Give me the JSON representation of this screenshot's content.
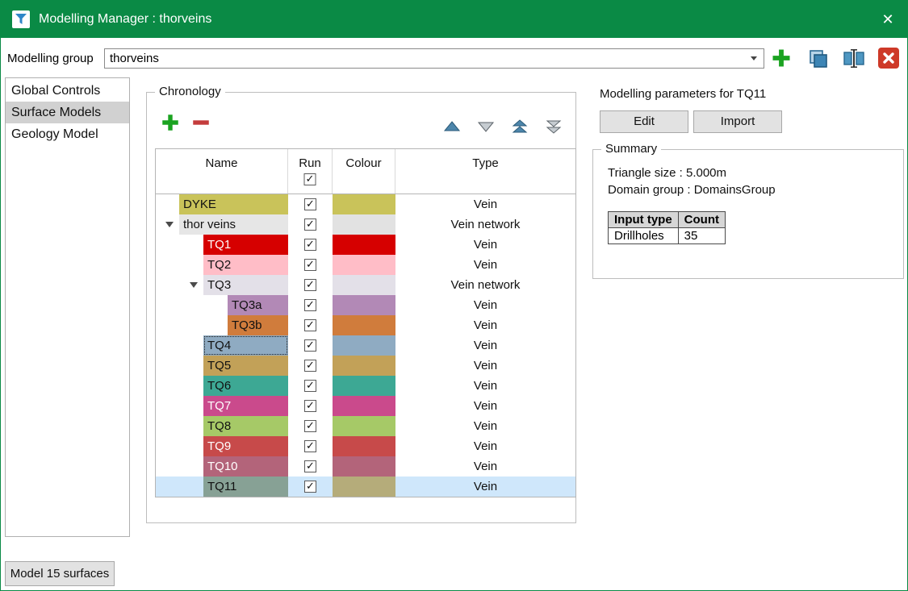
{
  "window": {
    "title": "Modelling Manager : thorveins",
    "close_icon": "✕"
  },
  "toolbar": {
    "group_label": "Modelling group",
    "group_value": "thorveins"
  },
  "icons": {
    "check": "✓"
  },
  "sidebar": {
    "items": [
      {
        "label": "Global Controls",
        "selected": false
      },
      {
        "label": "Surface Models",
        "selected": true
      },
      {
        "label": "Geology Model",
        "selected": false
      }
    ]
  },
  "chronology": {
    "title": "Chronology",
    "selection_color": "#cfe7fb",
    "header": {
      "name": "Name",
      "run": "Run",
      "colour": "Colour",
      "type": "Type",
      "run_all_checked": true
    },
    "rows": [
      {
        "name": "DYKE",
        "indent": 1,
        "expander": false,
        "checked": true,
        "color": "#c9c35a",
        "type": "Vein",
        "selected": false,
        "focus": false
      },
      {
        "name": "thor veins",
        "indent": 1,
        "expander": true,
        "checked": true,
        "color": "#e6e6e6",
        "swatch": "#e2e2e2",
        "type": "Vein network",
        "selected": false,
        "focus": false
      },
      {
        "name": "TQ1",
        "indent": 2,
        "expander": false,
        "checked": true,
        "color": "#d60000",
        "text_color": "#ffffff",
        "type": "Vein",
        "selected": false,
        "focus": false
      },
      {
        "name": "TQ2",
        "indent": 2,
        "expander": false,
        "checked": true,
        "color": "#ffbdc7",
        "type": "Vein",
        "selected": false,
        "focus": false
      },
      {
        "name": "TQ3",
        "indent": 2,
        "expander": true,
        "checked": true,
        "color": "#e3e0e8",
        "type": "Vein network",
        "selected": false,
        "focus": false
      },
      {
        "name": "TQ3a",
        "indent": 3,
        "expander": false,
        "checked": true,
        "color": "#b289b6",
        "type": "Vein",
        "selected": false,
        "focus": false
      },
      {
        "name": "TQ3b",
        "indent": 3,
        "expander": false,
        "checked": true,
        "color": "#d07c3c",
        "type": "Vein",
        "selected": false,
        "focus": false
      },
      {
        "name": "TQ4",
        "indent": 2,
        "expander": false,
        "checked": true,
        "color": "#8fabc2",
        "type": "Vein",
        "selected": false,
        "focus": true
      },
      {
        "name": "TQ5",
        "indent": 2,
        "expander": false,
        "checked": true,
        "color": "#c2a158",
        "type": "Vein",
        "selected": false,
        "focus": false
      },
      {
        "name": "TQ6",
        "indent": 2,
        "expander": false,
        "checked": true,
        "color": "#3da894",
        "type": "Vein",
        "selected": false,
        "focus": false
      },
      {
        "name": "TQ7",
        "indent": 2,
        "expander": false,
        "checked": true,
        "color": "#ca4a8c",
        "text_color": "#ffffff",
        "type": "Vein",
        "selected": false,
        "focus": false
      },
      {
        "name": "TQ8",
        "indent": 2,
        "expander": false,
        "checked": true,
        "color": "#a6c967",
        "type": "Vein",
        "selected": false,
        "focus": false
      },
      {
        "name": "TQ9",
        "indent": 2,
        "expander": false,
        "checked": true,
        "color": "#c74a4a",
        "text_color": "#ffffff",
        "type": "Vein",
        "selected": false,
        "focus": false
      },
      {
        "name": "TQ10",
        "indent": 2,
        "expander": false,
        "checked": true,
        "color": "#b3647a",
        "text_color": "#ffffff",
        "type": "Vein",
        "selected": false,
        "focus": false
      },
      {
        "name": "TQ11",
        "indent": 2,
        "expander": false,
        "checked": true,
        "color": "#87a195",
        "swatch": "#b5ac7a",
        "type": "Vein",
        "selected": true,
        "focus": false
      }
    ]
  },
  "params": {
    "title": "Modelling parameters for TQ11",
    "edit_button": "Edit",
    "import_button": "Import",
    "summary": {
      "title": "Summary",
      "triangle_size": "Triangle size : 5.000m",
      "domain_group": "Domain group : DomainsGroup",
      "table": {
        "headers": [
          "Input type",
          "Count"
        ],
        "rows": [
          [
            "Drillholes",
            "35"
          ]
        ]
      }
    }
  },
  "footer": {
    "model_button": "Model 15 surfaces"
  }
}
